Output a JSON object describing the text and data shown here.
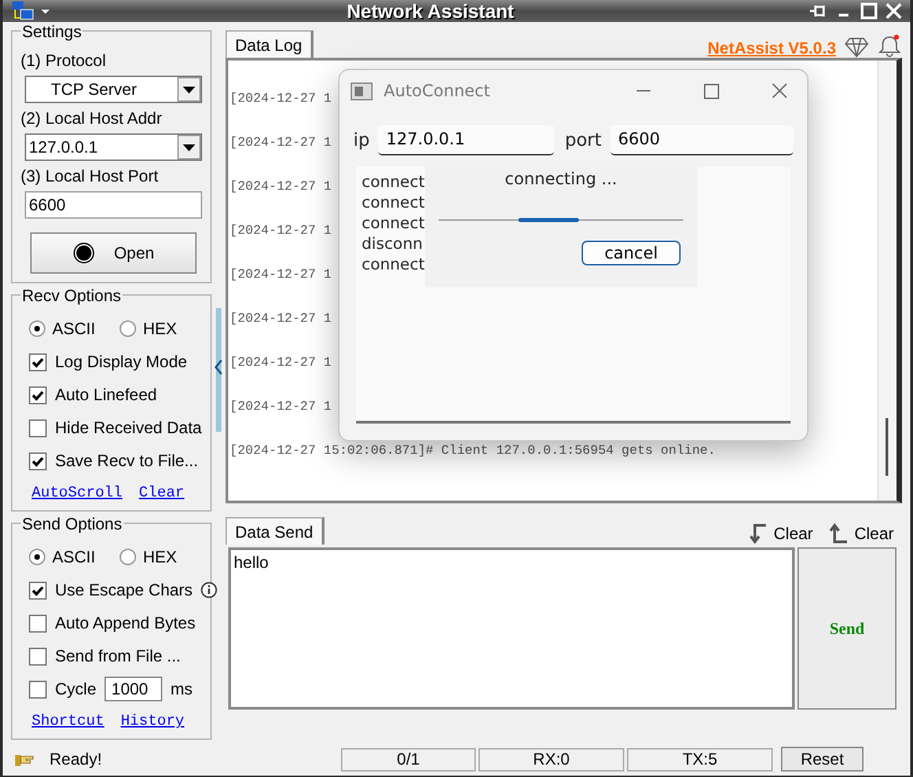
{
  "window": {
    "title": "Network Assistant"
  },
  "brand": "NetAssist V5.0.3",
  "settings": {
    "title": "Settings",
    "fields": [
      {
        "label": "(1) Protocol",
        "kind": "select",
        "value": "TCP Server"
      },
      {
        "label": "(2) Local Host Addr",
        "kind": "select",
        "value": "127.0.0.1"
      },
      {
        "label": "(3) Local Host Port",
        "kind": "input",
        "value": "6600"
      }
    ],
    "open_button": "Open"
  },
  "recv_options": {
    "title": "Recv Options",
    "encodings": [
      {
        "label": "ASCII",
        "selected": true
      },
      {
        "label": "HEX",
        "selected": false
      }
    ],
    "checks": [
      {
        "label": "Log Display Mode",
        "checked": true
      },
      {
        "label": "Auto Linefeed",
        "checked": true
      },
      {
        "label": "Hide Received Data",
        "checked": false
      },
      {
        "label": "Save Recv to File...",
        "checked": true
      }
    ],
    "links": [
      "AutoScroll",
      "Clear"
    ]
  },
  "send_options": {
    "title": "Send Options",
    "encodings": [
      {
        "label": "ASCII",
        "selected": true
      },
      {
        "label": "HEX",
        "selected": false
      }
    ],
    "checks": [
      {
        "label": "Use Escape Chars",
        "checked": true,
        "info": true
      },
      {
        "label": "Auto Append Bytes",
        "checked": false
      },
      {
        "label": "Send from File ...",
        "checked": false
      }
    ],
    "cycle": {
      "label": "Cycle",
      "checked": false,
      "value": "1000",
      "unit": "ms"
    },
    "links": [
      "Shortcut",
      "History"
    ]
  },
  "data_log": {
    "tab": "Data Log",
    "lines": [
      "[2024-12-27 1",
      "[2024-12-27 1",
      "[2024-12-27 1",
      "[2024-12-27 1",
      "[2024-12-27 1",
      "[2024-12-27 1",
      "[2024-12-27 1",
      "[2024-12-27 1",
      "[2024-12-27 15:02:06.871]# Client 127.0.0.1:56954 gets online."
    ]
  },
  "data_send": {
    "tab": "Data Send",
    "clear_buttons": [
      "Clear",
      "Clear"
    ],
    "text": "hello",
    "send_button": "Send"
  },
  "status_bar": {
    "message": "Ready!",
    "counters": [
      "0/1",
      "RX:0",
      "TX:5"
    ],
    "reset_button": "Reset"
  },
  "dialog": {
    "title": "AutoConnect",
    "ip_label": "ip",
    "ip": "127.0.0.1",
    "port_label": "port",
    "port": "6600",
    "log": [
      "connect",
      "connect",
      "connect",
      "disconn",
      "connect"
    ],
    "status": "connecting ...",
    "cancel_button": "cancel"
  }
}
